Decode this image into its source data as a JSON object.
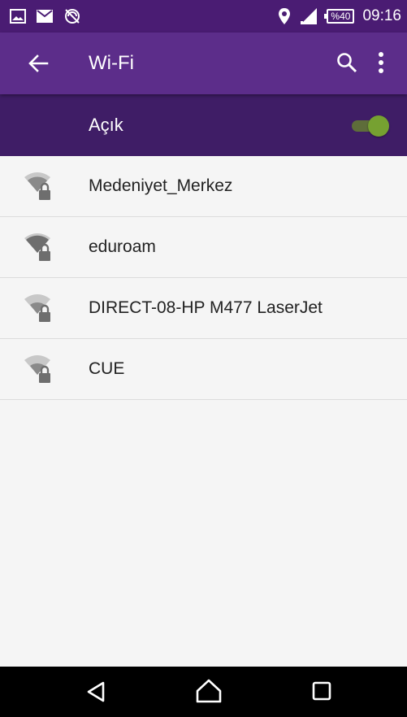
{
  "status_bar": {
    "battery": "%40",
    "time": "09:16",
    "left_icons": [
      "image-icon",
      "mail-icon",
      "sync-disabled-icon"
    ],
    "right_icons": [
      "location-icon",
      "signal-icon",
      "battery-icon"
    ]
  },
  "app_bar": {
    "title": "Wi-Fi",
    "back_icon": "arrow-back-icon",
    "search_icon": "search-icon",
    "more_icon": "more-vert-icon"
  },
  "wifi_toggle": {
    "label": "Açık",
    "state": "on",
    "accent": "#76a131"
  },
  "networks": [
    {
      "ssid": "Medeniyet_Merkez",
      "secured": true
    },
    {
      "ssid": "eduroam",
      "secured": true
    },
    {
      "ssid": "DIRECT-08-HP M477 LaserJet",
      "secured": true
    },
    {
      "ssid": "CUE",
      "secured": true
    }
  ],
  "nav_bar": {
    "back": "nav-back-icon",
    "home": "nav-home-icon",
    "recents": "nav-recents-icon"
  },
  "colors": {
    "status_bar": "#4a1c73",
    "app_bar": "#5c2d8a",
    "toggle_bar": "#3f1d66",
    "list_background": "#f5f5f5"
  }
}
